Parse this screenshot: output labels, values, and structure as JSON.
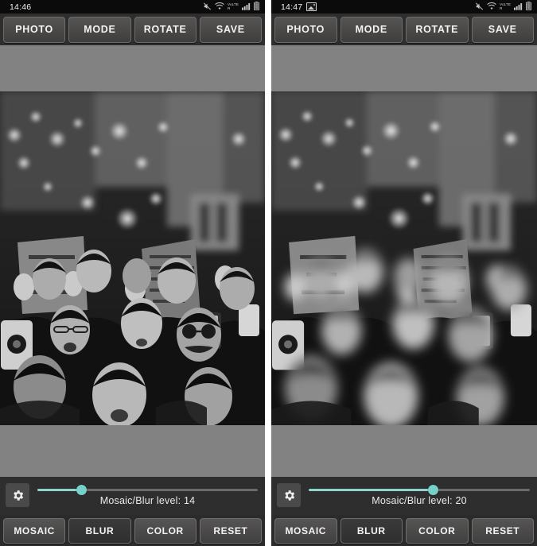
{
  "panels": [
    {
      "id": "before",
      "status": {
        "time": "14:46",
        "has_gallery_icon": false,
        "icons": [
          "mute-icon",
          "wifi-icon",
          "volte-icon",
          "signal-icon",
          "battery-icon"
        ],
        "network_label_top": "VoLTE",
        "network_label_bottom": "R"
      },
      "toolbar": [
        {
          "name": "photo-button",
          "label": "PHOTO"
        },
        {
          "name": "mode-button",
          "label": "MODE"
        },
        {
          "name": "rotate-button",
          "label": "ROTATE"
        },
        {
          "name": "save-button",
          "label": "SAVE"
        }
      ],
      "photo": {
        "description": "black and white photograph of a dense protest crowd at night with banners and raised hands",
        "faces_blurred": false
      },
      "slider": {
        "label": "Mosaic/Blur level: 14",
        "value": 14,
        "min": 1,
        "max": 80,
        "percent": 20,
        "track_color": "#8fd4cd",
        "thumb_color": "#76d2c9"
      },
      "gear": {
        "name": "settings-gear-icon"
      },
      "bottom": [
        {
          "name": "mosaic-button",
          "label": "MOSAIC",
          "selected": false
        },
        {
          "name": "blur-button",
          "label": "BLUR",
          "selected": true
        },
        {
          "name": "color-button",
          "label": "COLOR",
          "selected": false
        },
        {
          "name": "reset-button",
          "label": "RESET",
          "selected": false
        }
      ]
    },
    {
      "id": "after",
      "status": {
        "time": "14:47",
        "has_gallery_icon": true,
        "icons": [
          "gallery-icon",
          "mute-icon",
          "wifi-icon",
          "volte-icon",
          "signal-icon",
          "battery-icon"
        ],
        "network_label_top": "VoLTE",
        "network_label_bottom": "R"
      },
      "toolbar": [
        {
          "name": "photo-button",
          "label": "PHOTO"
        },
        {
          "name": "mode-button",
          "label": "MODE"
        },
        {
          "name": "rotate-button",
          "label": "ROTATE"
        },
        {
          "name": "save-button",
          "label": "SAVE"
        }
      ],
      "photo": {
        "description": "same crowd photograph with every face blurred out",
        "faces_blurred": true
      },
      "slider": {
        "label": "Mosaic/Blur level: 20",
        "value": 20,
        "min": 1,
        "max": 80,
        "percent": 56,
        "track_color": "#8fd4cd",
        "thumb_color": "#76d2c9"
      },
      "gear": {
        "name": "settings-gear-icon"
      },
      "bottom": [
        {
          "name": "mosaic-button",
          "label": "MOSAIC",
          "selected": false
        },
        {
          "name": "blur-button",
          "label": "BLUR",
          "selected": true
        },
        {
          "name": "color-button",
          "label": "COLOR",
          "selected": false
        },
        {
          "name": "reset-button",
          "label": "RESET",
          "selected": false
        }
      ]
    }
  ],
  "colors": {
    "status_bar_bg": "#0b0b0b",
    "toolbar_bg": "#2e2e2e",
    "canvas_bg": "#828282",
    "button_face": "#4b4a49",
    "button_selected": "#353535",
    "accent": "#76d2c9",
    "text": "#f3f3f3",
    "panel_divider": "#ffffff"
  }
}
